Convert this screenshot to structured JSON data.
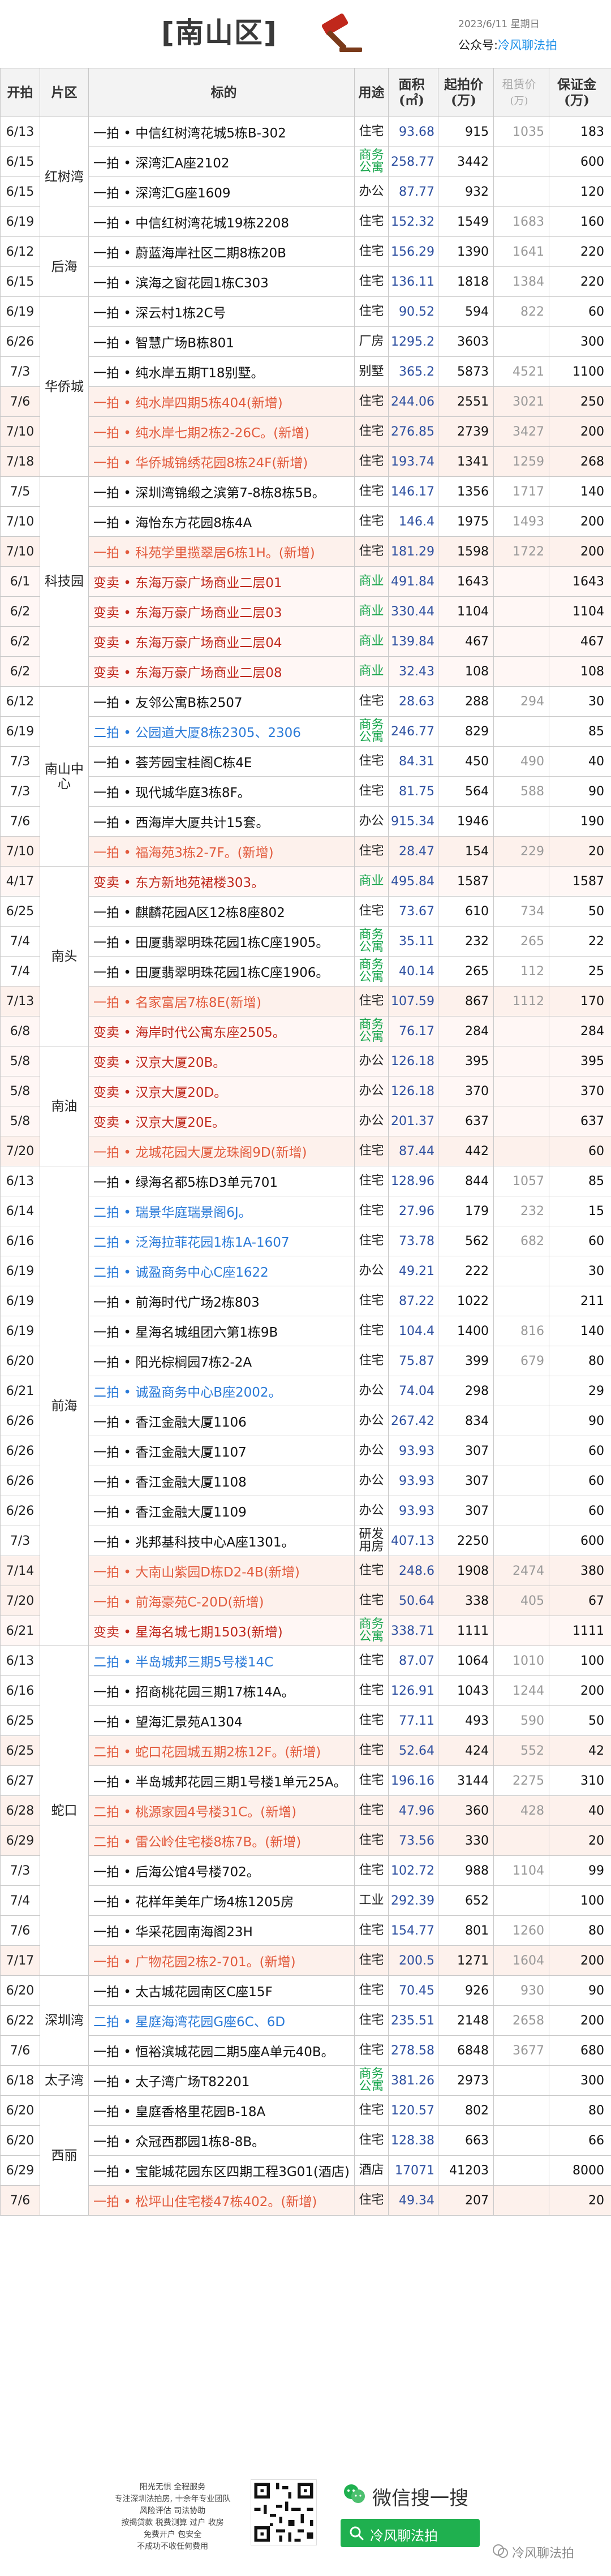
{
  "header": {
    "title": "[南山区]",
    "date": "2023/6/11  星期日",
    "gzh_label": "公众号:",
    "gzh_name": "冷风聊法拍"
  },
  "columns": {
    "date": "开拍",
    "area": "片区",
    "item": "标的",
    "use": "用途",
    "sqm": "面积(㎡)",
    "price": "起拍价(万)",
    "rent": "租赁价",
    "rent_unit": "(万)",
    "deposit": "保证金(万)"
  },
  "groups": [
    {
      "area": "红树湾",
      "rows": [
        {
          "date": "6/13",
          "item": "一拍 • 中信红树湾花城5栋B-302",
          "use": "住宅",
          "sqm": "93.68",
          "price": "915",
          "rent": "1035",
          "deposit": "183",
          "style": ""
        },
        {
          "date": "6/15",
          "item": "一拍 • 深湾汇A座2102",
          "use": "商务公寓",
          "sqm": "258.77",
          "price": "3442",
          "rent": "",
          "deposit": "600",
          "style": "",
          "use_green": true
        },
        {
          "date": "6/15",
          "item": "一拍 • 深湾汇G座1609",
          "use": "办公",
          "sqm": "87.77",
          "price": "932",
          "rent": "",
          "deposit": "120",
          "style": ""
        },
        {
          "date": "6/19",
          "item": "一拍 • 中信红树湾花城19栋2208",
          "use": "住宅",
          "sqm": "152.32",
          "price": "1549",
          "rent": "1683",
          "deposit": "160",
          "style": ""
        }
      ]
    },
    {
      "area": "后海",
      "rows": [
        {
          "date": "6/12",
          "item": "一拍 • 蔚蓝海岸社区二期8栋20B",
          "use": "住宅",
          "sqm": "156.29",
          "price": "1390",
          "rent": "1641",
          "deposit": "220",
          "style": ""
        },
        {
          "date": "6/15",
          "item": "一拍 • 滨海之窗花园1栋C303",
          "use": "住宅",
          "sqm": "136.11",
          "price": "1818",
          "rent": "1384",
          "deposit": "220",
          "style": ""
        }
      ]
    },
    {
      "area": "华侨城",
      "rows": [
        {
          "date": "6/19",
          "item": "一拍 • 深云村1栋2C号",
          "use": "住宅",
          "sqm": "90.52",
          "price": "594",
          "rent": "822",
          "deposit": "60",
          "style": ""
        },
        {
          "date": "6/26",
          "item": "一拍 • 智慧广场B栋801",
          "use": "厂房",
          "sqm": "1295.2",
          "price": "3603",
          "rent": "",
          "deposit": "300",
          "style": ""
        },
        {
          "date": "7/3",
          "item": "一拍 • 纯水岸五期T18别墅。",
          "use": "别墅",
          "sqm": "365.2",
          "price": "5873",
          "rent": "4521",
          "deposit": "1100",
          "style": ""
        },
        {
          "date": "7/6",
          "item": "一拍 • 纯水岸四期5栋404(新增)",
          "use": "住宅",
          "sqm": "244.06",
          "price": "2551",
          "rent": "3021",
          "deposit": "250",
          "style": "new"
        },
        {
          "date": "7/10",
          "item": "一拍 • 纯水岸七期2栋2-26C。(新增)",
          "use": "住宅",
          "sqm": "276.85",
          "price": "2739",
          "rent": "3427",
          "deposit": "200",
          "style": "new"
        },
        {
          "date": "7/18",
          "item": "一拍 • 华侨城锦绣花园8栋24F(新增)",
          "use": "住宅",
          "sqm": "193.74",
          "price": "1341",
          "rent": "1259",
          "deposit": "268",
          "style": "new"
        }
      ]
    },
    {
      "area": "科技园",
      "rows": [
        {
          "date": "7/5",
          "item": "一拍 • 深圳湾锦缎之滨第7-8栋8栋5B。",
          "use": "住宅",
          "sqm": "146.17",
          "price": "1356",
          "rent": "1717",
          "deposit": "140",
          "style": ""
        },
        {
          "date": "7/10",
          "item": "一拍 • 海怡东方花园8栋4A",
          "use": "住宅",
          "sqm": "146.4",
          "price": "1975",
          "rent": "1493",
          "deposit": "200",
          "style": ""
        },
        {
          "date": "7/10",
          "item": "一拍 • 科苑学里揽翠居6栋1H。(新增)",
          "use": "住宅",
          "sqm": "181.29",
          "price": "1598",
          "rent": "1722",
          "deposit": "200",
          "style": "new"
        },
        {
          "date": "6/1",
          "item": "变卖 • 东海万豪广场商业二层01",
          "use": "商业",
          "sqm": "491.84",
          "price": "1643",
          "rent": "",
          "deposit": "1643",
          "style": "red",
          "use_green": true
        },
        {
          "date": "6/2",
          "item": "变卖 • 东海万豪广场商业二层03",
          "use": "商业",
          "sqm": "330.44",
          "price": "1104",
          "rent": "",
          "deposit": "1104",
          "style": "red",
          "use_green": true
        },
        {
          "date": "6/2",
          "item": "变卖 • 东海万豪广场商业二层04",
          "use": "商业",
          "sqm": "139.84",
          "price": "467",
          "rent": "",
          "deposit": "467",
          "style": "red",
          "use_green": true
        },
        {
          "date": "6/2",
          "item": "变卖 • 东海万豪广场商业二层08",
          "use": "商业",
          "sqm": "32.43",
          "price": "108",
          "rent": "",
          "deposit": "108",
          "style": "red",
          "use_green": true
        }
      ]
    },
    {
      "area": "南山中心",
      "rows": [
        {
          "date": "6/12",
          "item": "一拍 • 友邻公寓B栋2507",
          "use": "住宅",
          "sqm": "28.63",
          "price": "288",
          "rent": "294",
          "deposit": "30",
          "style": ""
        },
        {
          "date": "6/19",
          "item": "二拍 • 公园道大厦8栋2305、2306",
          "use": "商务公寓",
          "sqm": "246.77",
          "price": "829",
          "rent": "",
          "deposit": "85",
          "style": "blue",
          "use_green": true
        },
        {
          "date": "7/3",
          "item": "一拍 • 荟芳园宝桂阁C栋4E",
          "use": "住宅",
          "sqm": "84.31",
          "price": "450",
          "rent": "490",
          "deposit": "40",
          "style": ""
        },
        {
          "date": "7/3",
          "item": "一拍 • 现代城华庭3栋8F。",
          "use": "住宅",
          "sqm": "81.75",
          "price": "564",
          "rent": "588",
          "deposit": "90",
          "style": ""
        },
        {
          "date": "7/6",
          "item": "一拍 • 西海岸大厦共计15套。",
          "use": "办公",
          "sqm": "915.34",
          "price": "1946",
          "rent": "",
          "deposit": "190",
          "style": ""
        },
        {
          "date": "7/10",
          "item": "一拍 • 福海苑3栋2-7F。(新增)",
          "use": "住宅",
          "sqm": "28.47",
          "price": "154",
          "rent": "229",
          "deposit": "20",
          "style": "new"
        }
      ]
    },
    {
      "area": "南头",
      "rows": [
        {
          "date": "4/17",
          "item": "变卖 • 东方新地苑裙楼303。",
          "use": "商业",
          "sqm": "495.84",
          "price": "1587",
          "rent": "",
          "deposit": "1587",
          "style": "red",
          "use_green": true
        },
        {
          "date": "6/25",
          "item": "一拍 • 麒麟花园A区12栋8座802",
          "use": "住宅",
          "sqm": "73.67",
          "price": "610",
          "rent": "734",
          "deposit": "50",
          "style": ""
        },
        {
          "date": "7/4",
          "item": "一拍 • 田厦翡翠明珠花园1栋C座1905。",
          "use": "商务公寓",
          "sqm": "35.11",
          "price": "232",
          "rent": "265",
          "deposit": "22",
          "style": "",
          "use_green": true
        },
        {
          "date": "7/4",
          "item": "一拍 • 田厦翡翠明珠花园1栋C座1906。",
          "use": "商务公寓",
          "sqm": "40.14",
          "price": "265",
          "rent": "112",
          "deposit": "25",
          "style": "",
          "use_green": true
        },
        {
          "date": "7/13",
          "item": "一拍 • 名家富居7栋8E(新增)",
          "use": "住宅",
          "sqm": "107.59",
          "price": "867",
          "rent": "1112",
          "deposit": "170",
          "style": "new"
        },
        {
          "date": "6/8",
          "item": "变卖 • 海岸时代公寓东座2505。",
          "use": "商务公寓",
          "sqm": "76.17",
          "price": "284",
          "rent": "",
          "deposit": "284",
          "style": "red",
          "use_green": true
        }
      ]
    },
    {
      "area": "南油",
      "rows": [
        {
          "date": "5/8",
          "item": "变卖 • 汉京大厦20B。",
          "use": "办公",
          "sqm": "126.18",
          "price": "395",
          "rent": "",
          "deposit": "395",
          "style": "red"
        },
        {
          "date": "5/8",
          "item": "变卖 • 汉京大厦20D。",
          "use": "办公",
          "sqm": "126.18",
          "price": "370",
          "rent": "",
          "deposit": "370",
          "style": "red"
        },
        {
          "date": "5/8",
          "item": "变卖 • 汉京大厦20E。",
          "use": "办公",
          "sqm": "201.37",
          "price": "637",
          "rent": "",
          "deposit": "637",
          "style": "red"
        },
        {
          "date": "7/20",
          "item": "一拍 • 龙城花园大厦龙珠阁9D(新增)",
          "use": "住宅",
          "sqm": "87.44",
          "price": "442",
          "rent": "",
          "deposit": "60",
          "style": "new"
        }
      ]
    },
    {
      "area": "前海",
      "rows": [
        {
          "date": "6/13",
          "item": "一拍 • 绿海名都5栋D3单元701",
          "use": "住宅",
          "sqm": "128.96",
          "price": "844",
          "rent": "1057",
          "deposit": "85",
          "style": ""
        },
        {
          "date": "6/14",
          "item": "二拍 • 瑞景华庭瑞景阁6J。",
          "use": "住宅",
          "sqm": "27.96",
          "price": "179",
          "rent": "232",
          "deposit": "15",
          "style": "blue"
        },
        {
          "date": "6/16",
          "item": "二拍 • 泛海拉菲花园1栋1A-1607",
          "use": "住宅",
          "sqm": "73.78",
          "price": "562",
          "rent": "682",
          "deposit": "60",
          "style": "blue"
        },
        {
          "date": "6/19",
          "item": "二拍 • 诚盈商务中心C座1622",
          "use": "办公",
          "sqm": "49.21",
          "price": "222",
          "rent": "",
          "deposit": "30",
          "style": "blue"
        },
        {
          "date": "6/19",
          "item": "一拍 • 前海时代广场2栋803",
          "use": "住宅",
          "sqm": "87.22",
          "price": "1022",
          "rent": "",
          "deposit": "211",
          "style": ""
        },
        {
          "date": "6/19",
          "item": "一拍 • 星海名城组团六第1栋9B",
          "use": "住宅",
          "sqm": "104.4",
          "price": "1400",
          "rent": "816",
          "deposit": "140",
          "style": ""
        },
        {
          "date": "6/20",
          "item": "一拍 • 阳光棕榈园7栋2-2A",
          "use": "住宅",
          "sqm": "75.87",
          "price": "399",
          "rent": "679",
          "deposit": "80",
          "style": ""
        },
        {
          "date": "6/21",
          "item": "二拍 • 诚盈商务中心B座2002。",
          "use": "办公",
          "sqm": "74.04",
          "price": "298",
          "rent": "",
          "deposit": "29",
          "style": "blue"
        },
        {
          "date": "6/26",
          "item": "一拍 • 香江金融大厦1106",
          "use": "办公",
          "sqm": "267.42",
          "price": "834",
          "rent": "",
          "deposit": "90",
          "style": ""
        },
        {
          "date": "6/26",
          "item": "一拍 • 香江金融大厦1107",
          "use": "办公",
          "sqm": "93.93",
          "price": "307",
          "rent": "",
          "deposit": "60",
          "style": ""
        },
        {
          "date": "6/26",
          "item": "一拍 • 香江金融大厦1108",
          "use": "办公",
          "sqm": "93.93",
          "price": "307",
          "rent": "",
          "deposit": "60",
          "style": ""
        },
        {
          "date": "6/26",
          "item": "一拍 • 香江金融大厦1109",
          "use": "办公",
          "sqm": "93.93",
          "price": "307",
          "rent": "",
          "deposit": "60",
          "style": ""
        },
        {
          "date": "7/3",
          "item": "一拍 • 兆邦基科技中心A座1301。",
          "use": "研发用房",
          "sqm": "407.13",
          "price": "2250",
          "rent": "",
          "deposit": "600",
          "style": ""
        },
        {
          "date": "7/14",
          "item": "一拍 • 大南山紫园D栋D2-4B(新增)",
          "use": "住宅",
          "sqm": "248.6",
          "price": "1908",
          "rent": "2474",
          "deposit": "380",
          "style": "new"
        },
        {
          "date": "7/20",
          "item": "一拍 • 前海豪苑C-20D(新增)",
          "use": "住宅",
          "sqm": "50.64",
          "price": "338",
          "rent": "405",
          "deposit": "67",
          "style": "new"
        },
        {
          "date": "6/21",
          "item": "变卖 • 星海名城七期1503(新增)",
          "use": "商务公寓",
          "sqm": "338.71",
          "price": "1111",
          "rent": "",
          "deposit": "1111",
          "style": "red",
          "use_green": true
        }
      ]
    },
    {
      "area": "蛇口",
      "rows": [
        {
          "date": "6/13",
          "item": "二拍 • 半岛城邦三期5号楼14C",
          "use": "住宅",
          "sqm": "87.07",
          "price": "1064",
          "rent": "1010",
          "deposit": "100",
          "style": "blue"
        },
        {
          "date": "6/16",
          "item": "一拍 • 招商桃花园三期17栋14A。",
          "use": "住宅",
          "sqm": "126.91",
          "price": "1043",
          "rent": "1244",
          "deposit": "200",
          "style": ""
        },
        {
          "date": "6/25",
          "item": "一拍 • 望海汇景苑A1304",
          "use": "住宅",
          "sqm": "77.11",
          "price": "493",
          "rent": "590",
          "deposit": "50",
          "style": ""
        },
        {
          "date": "6/25",
          "item": "二拍 • 蛇口花园城五期2栋12F。(新增)",
          "use": "住宅",
          "sqm": "52.64",
          "price": "424",
          "rent": "552",
          "deposit": "42",
          "style": "new"
        },
        {
          "date": "6/27",
          "item": "一拍 • 半岛城邦花园三期1号楼1单元25A。",
          "use": "住宅",
          "sqm": "196.16",
          "price": "3144",
          "rent": "2275",
          "deposit": "310",
          "style": ""
        },
        {
          "date": "6/28",
          "item": "二拍 • 桃源家园4号楼31C。(新增)",
          "use": "住宅",
          "sqm": "47.96",
          "price": "360",
          "rent": "428",
          "deposit": "40",
          "style": "new"
        },
        {
          "date": "6/29",
          "item": "二拍 • 雷公岭住宅楼8栋7B。(新增)",
          "use": "住宅",
          "sqm": "73.56",
          "price": "330",
          "rent": "",
          "deposit": "20",
          "style": "new"
        },
        {
          "date": "7/3",
          "item": "一拍 • 后海公馆4号楼702。",
          "use": "住宅",
          "sqm": "102.72",
          "price": "988",
          "rent": "1104",
          "deposit": "99",
          "style": ""
        },
        {
          "date": "7/4",
          "item": "一拍 • 花样年美年广场4栋1205房",
          "use": "工业",
          "sqm": "292.39",
          "price": "652",
          "rent": "",
          "deposit": "100",
          "style": ""
        },
        {
          "date": "7/6",
          "item": "一拍 • 华采花园南海阁23H",
          "use": "住宅",
          "sqm": "154.77",
          "price": "801",
          "rent": "1260",
          "deposit": "80",
          "style": ""
        },
        {
          "date": "7/17",
          "item": "一拍 • 广物花园2栋2-701。(新增)",
          "use": "住宅",
          "sqm": "200.5",
          "price": "1271",
          "rent": "1604",
          "deposit": "200",
          "style": "new"
        }
      ]
    },
    {
      "area": "深圳湾",
      "rows": [
        {
          "date": "6/20",
          "item": "一拍 • 太古城花园南区C座15F",
          "use": "住宅",
          "sqm": "70.45",
          "price": "926",
          "rent": "930",
          "deposit": "90",
          "style": ""
        },
        {
          "date": "6/22",
          "item": "二拍 • 星庭海湾花园G座6C、6D",
          "use": "住宅",
          "sqm": "235.51",
          "price": "2148",
          "rent": "2658",
          "deposit": "200",
          "style": "blue"
        },
        {
          "date": "7/6",
          "item": "一拍 • 恒裕滨城花园二期5座A单元40B。",
          "use": "住宅",
          "sqm": "278.58",
          "price": "6848",
          "rent": "3677",
          "deposit": "680",
          "style": ""
        }
      ]
    },
    {
      "area": "太子湾",
      "rows": [
        {
          "date": "6/18",
          "item": "一拍 • 太子湾广场T82201",
          "use": "商务公寓",
          "sqm": "381.26",
          "price": "2973",
          "rent": "",
          "deposit": "300",
          "style": "",
          "use_green": true
        }
      ]
    },
    {
      "area": "西丽",
      "rows": [
        {
          "date": "6/20",
          "item": "一拍 • 皇庭香格里花园B-18A",
          "use": "住宅",
          "sqm": "120.57",
          "price": "802",
          "rent": "",
          "deposit": "80",
          "style": ""
        },
        {
          "date": "6/20",
          "item": "一拍 • 众冠西郡园1栋8-8B。",
          "use": "住宅",
          "sqm": "128.38",
          "price": "663",
          "rent": "",
          "deposit": "66",
          "style": ""
        },
        {
          "date": "6/29",
          "item": "一拍 • 宝能城花园东区四期工程3G01(酒店)",
          "use": "酒店",
          "sqm": "17071",
          "price": "41203",
          "rent": "",
          "deposit": "8000",
          "style": ""
        },
        {
          "date": "7/6",
          "item": "一拍 • 松坪山住宅楼47栋402。(新增)",
          "use": "住宅",
          "sqm": "49.34",
          "price": "207",
          "rent": "",
          "deposit": "20",
          "style": "new"
        }
      ]
    }
  ],
  "footer": {
    "tagline": "阳光无惧 全程服务\n专注深圳法拍房, 十余年专业团队\n风险评估 司法协助\n按揭贷款 税费测算 过户 收房\n免费开户 包安全\n不成功不收任何费用",
    "wechat_search": "微信搜一搜",
    "search_name": "冷风聊法拍",
    "watermark": "冷风聊法拍"
  },
  "colors": {
    "new_text": "#e25a3c",
    "second_auction_text": "#2a7ad8",
    "sale_text": "#c0281c",
    "green_use": "#1aa64e",
    "wechat_green": "#1fb04f"
  }
}
